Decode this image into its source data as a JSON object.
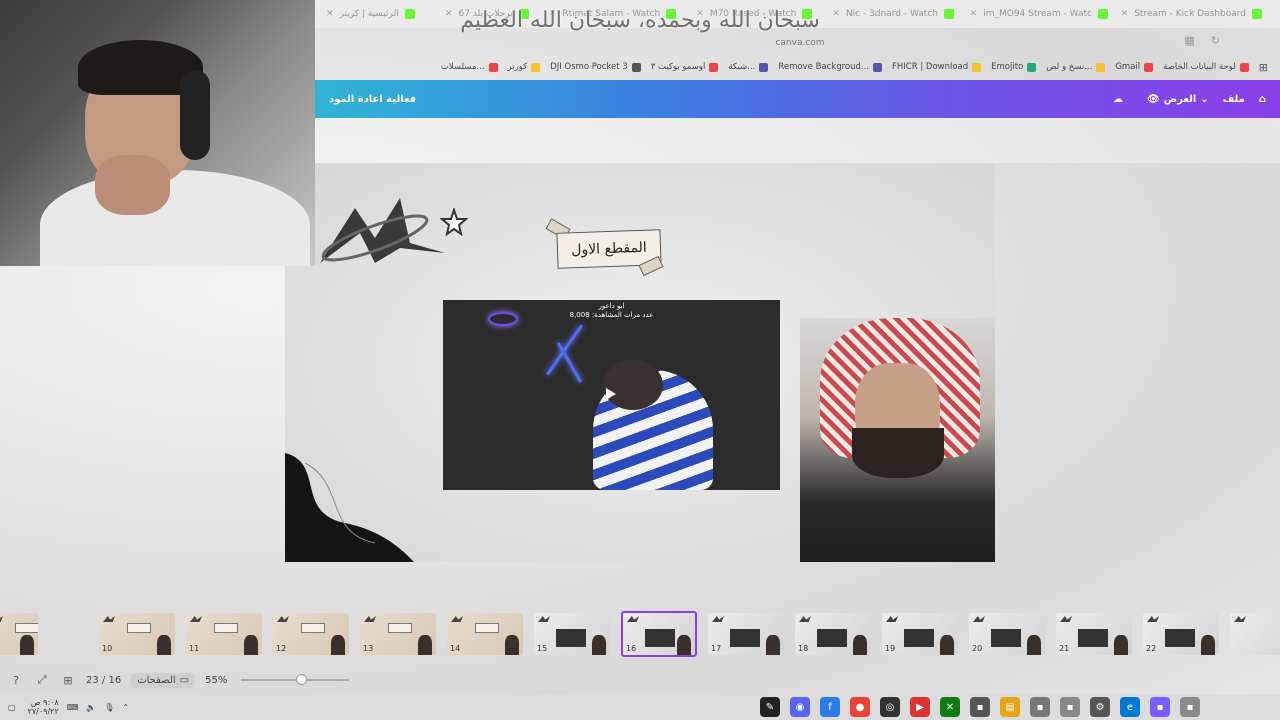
{
  "overlay_title": "سبحان الله وبحمده، سبحان الله العظيم",
  "browser": {
    "tabs": [
      {
        "label": "Stream - Kick Dashboard",
        "favicon": "kick-icon"
      },
      {
        "label": "im_MO94 Stream - Watc",
        "favicon": "kick-icon"
      },
      {
        "label": "Nic - 3dnard - Watch",
        "favicon": "kick-icon"
      },
      {
        "label": "M70 Rased - Watch",
        "favicon": "kick-icon"
      },
      {
        "label": "Rtimat Salam - Watch",
        "favicon": "kick-icon"
      },
      {
        "label": "برحلات بلد 67",
        "favicon": "kick-icon"
      },
      {
        "label": "الرئيسية | كريتر",
        "favicon": "kick-icon"
      }
    ],
    "address": "canva.com",
    "bookmarks": [
      {
        "label": "لوحة البيانات الخاصة",
        "color": "#e44"
      },
      {
        "label": "Gmail",
        "color": "#e44"
      },
      {
        "label": "نسخ و لص...",
        "color": "#f2c230"
      },
      {
        "label": "Emojito",
        "color": "#2a7"
      },
      {
        "label": "FHICR | Download",
        "color": "#f2c230"
      },
      {
        "label": "Remove Backgroud...",
        "color": "#55a"
      },
      {
        "label": "شبكة...",
        "color": "#55a"
      },
      {
        "label": "اوسمو بوكيت ٣",
        "color": "#e44"
      },
      {
        "label": "DJI Osmo Pocket 3",
        "color": "#555"
      },
      {
        "label": "كورتر",
        "color": "#f2c230"
      },
      {
        "label": "مسلسلات...",
        "color": "#e44"
      }
    ]
  },
  "canva": {
    "menu_file": "ملف",
    "view_mode": "العرض",
    "project_title": "فعالية اعادة المود",
    "page_heading": "المقطع الاول",
    "video_caption_line1": "ابو داعور",
    "video_caption_line2": "عدد مرات المشاهدة: 8,008",
    "footer": {
      "zoom": "55%",
      "pages_label": "الصفحات",
      "page_counter": "23 / 16"
    },
    "thumbnails": [
      {
        "num": "9",
        "style": "tan"
      },
      {
        "num": "10",
        "style": "tan"
      },
      {
        "num": "11",
        "style": "tan"
      },
      {
        "num": "12",
        "style": "tan"
      },
      {
        "num": "13",
        "style": "tan"
      },
      {
        "num": "14",
        "style": "tan"
      },
      {
        "num": "15",
        "style": "gray"
      },
      {
        "num": "16",
        "style": "gray",
        "active": true
      },
      {
        "num": "17",
        "style": "gray"
      },
      {
        "num": "18",
        "style": "gray"
      },
      {
        "num": "19",
        "style": "gray"
      },
      {
        "num": "20",
        "style": "gray"
      },
      {
        "num": "21",
        "style": "gray"
      },
      {
        "num": "22",
        "style": "gray"
      },
      {
        "num": "",
        "style": "gray"
      }
    ]
  },
  "taskbar": {
    "time": "٩:٠٨ ص",
    "date": "٢٧/٠٩/٢٢",
    "apps": [
      "editor-icon",
      "discord-icon",
      "files-icon",
      "chrome-icon",
      "obs-icon",
      "app-red-icon",
      "xbox-icon",
      "app-icon",
      "folder-icon",
      "app-icon",
      "app-icon",
      "settings-icon",
      "edge-icon",
      "app-icon",
      "app-icon"
    ]
  },
  "colors": {
    "accent_purple": "#8b3fe8",
    "accent_blue": "#3b7fe0",
    "kick_green": "#53fc18"
  }
}
